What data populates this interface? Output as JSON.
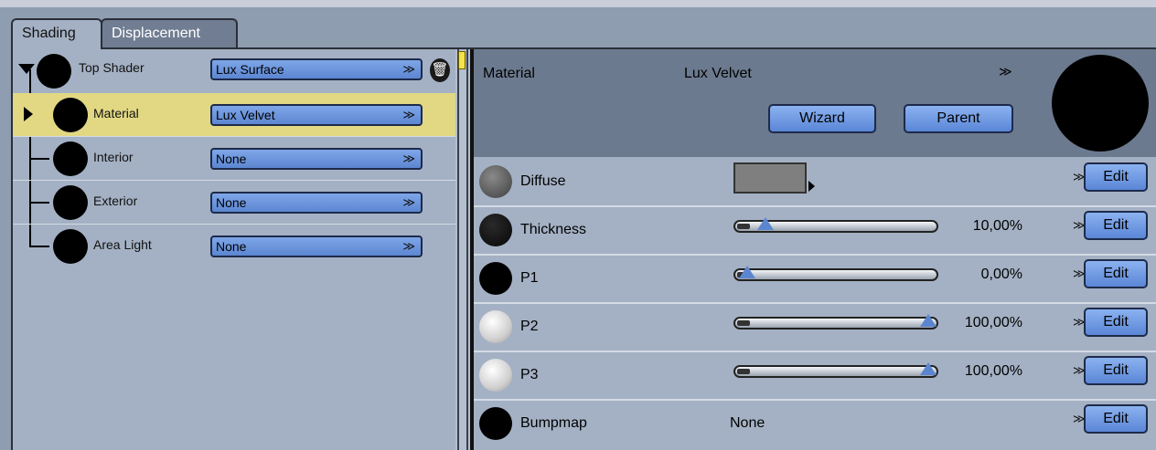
{
  "tabs": [
    {
      "label": "Shading",
      "active": true
    },
    {
      "label": "Displacement",
      "active": false
    }
  ],
  "tree": [
    {
      "label": "Top Shader",
      "value": "Lux Surface",
      "selected": false
    },
    {
      "label": "Material",
      "value": "Lux Velvet",
      "selected": true
    },
    {
      "label": "Interior",
      "value": "None",
      "selected": false
    },
    {
      "label": "Exterior",
      "value": "None",
      "selected": false
    },
    {
      "label": "Area Light",
      "value": "None",
      "selected": false
    }
  ],
  "material": {
    "label": "Material",
    "value": "Lux Velvet",
    "wizard_label": "Wizard",
    "parent_label": "Parent"
  },
  "params": [
    {
      "name": "Diffuse",
      "kind": "color",
      "swatch": "#7f7f7f",
      "ball": "#6a6a6a"
    },
    {
      "name": "Thickness",
      "kind": "slider",
      "value": "10,00%",
      "fraction": 0.1,
      "ball": "#141414"
    },
    {
      "name": "P1",
      "kind": "slider",
      "value": "0,00%",
      "fraction": 0.0,
      "ball": "#000000"
    },
    {
      "name": "P2",
      "kind": "slider",
      "value": "100,00%",
      "fraction": 1.0,
      "ball": "#e6e6e6"
    },
    {
      "name": "P3",
      "kind": "slider",
      "value": "100,00%",
      "fraction": 1.0,
      "ball": "#e6e6e6"
    },
    {
      "name": "Bumpmap",
      "kind": "text",
      "value": "None",
      "ball": "#000000"
    }
  ],
  "edit_label": "Edit",
  "colors": {
    "panel": "#a4b1c4",
    "header": "#6c7a8f",
    "selection": "#e2d883",
    "button": "#6f9ae0"
  }
}
